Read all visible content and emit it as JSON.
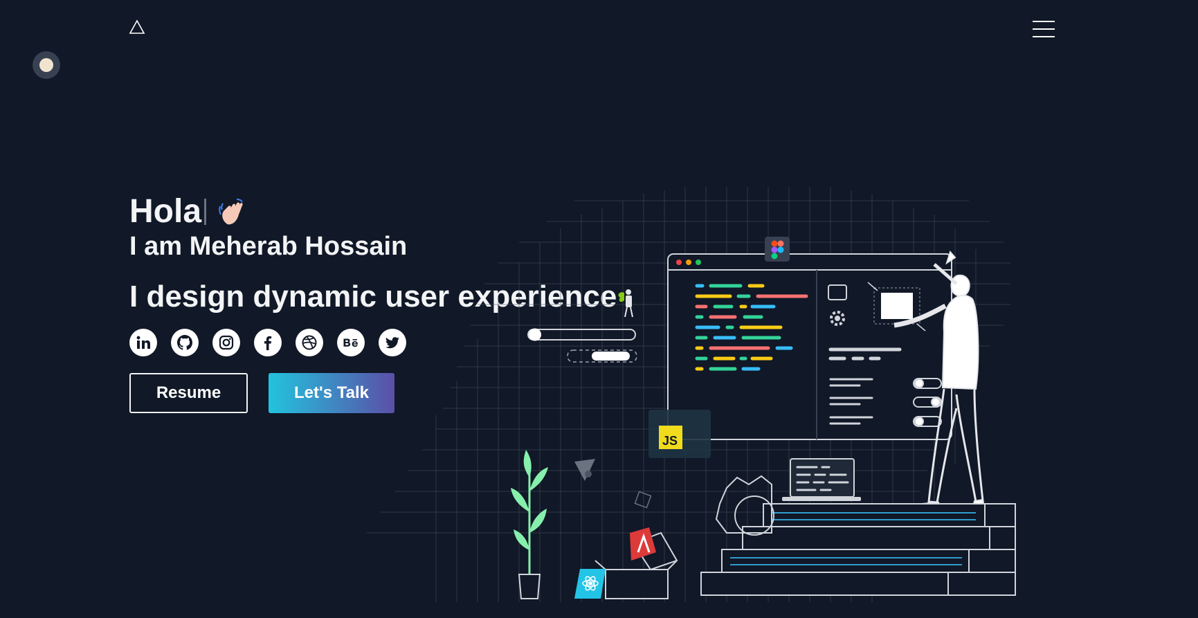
{
  "header": {
    "logo_icon": "triangle-logo-icon",
    "menu_icon": "hamburger-menu-icon"
  },
  "theme_toggle": {
    "icon": "sun-toggle-icon"
  },
  "hero": {
    "greeting": "Hola",
    "greeting_emoji": "waving-hand-icon",
    "name_line": "I am Meherab Hossain",
    "tagline": "I design dynamic user experience"
  },
  "socials": [
    {
      "icon": "linkedin-icon"
    },
    {
      "icon": "github-icon"
    },
    {
      "icon": "instagram-icon"
    },
    {
      "icon": "facebook-icon"
    },
    {
      "icon": "dribbble-icon"
    },
    {
      "icon": "behance-icon"
    },
    {
      "icon": "twitter-icon"
    }
  ],
  "buttons": {
    "resume": "Resume",
    "lets_talk": "Let's Talk"
  },
  "illustration": {
    "js_badge": "JS",
    "colors": {
      "bg": "#111827",
      "accent_from": "#22c3dd",
      "accent_to": "#5b4fa8",
      "js_yellow": "#f0db1c",
      "angular_red": "#dd3a3a",
      "react_cyan": "#23c4e6"
    }
  }
}
